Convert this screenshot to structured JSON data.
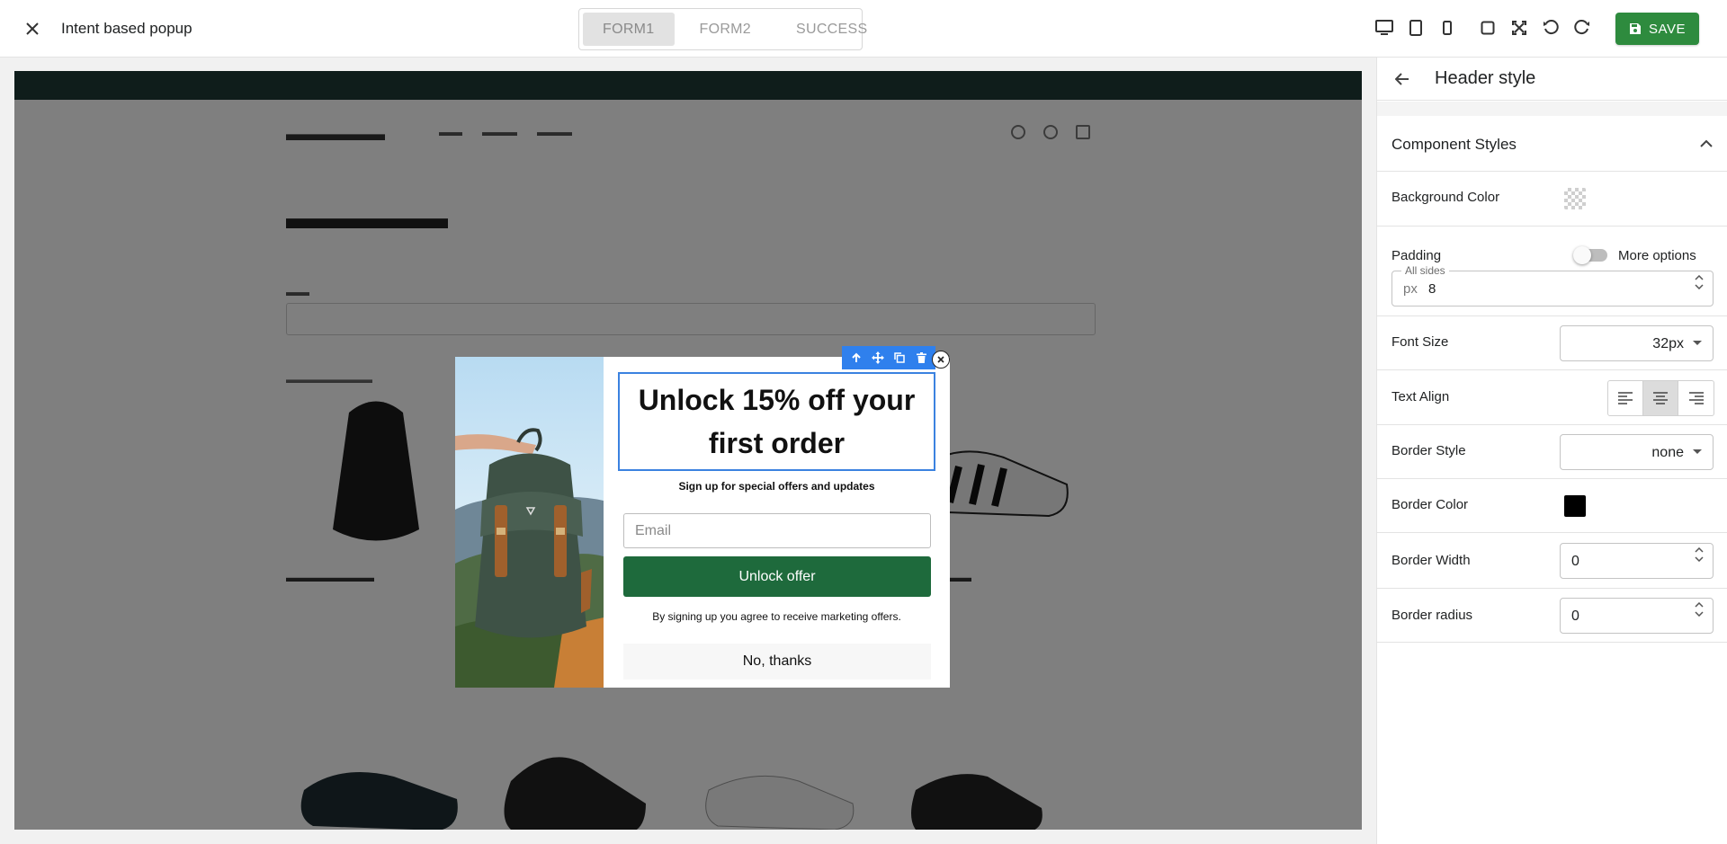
{
  "app": {
    "title": "Intent based popup"
  },
  "tabs": [
    "FORM1",
    "FORM2",
    "SUCCESS"
  ],
  "active_tab": "FORM1",
  "toolbar": {
    "save_label": "SAVE"
  },
  "popup": {
    "heading": "Unlock 15% off your first order",
    "subheading": "Sign up for special offers and updates",
    "email_placeholder": "Email",
    "submit_label": "Unlock offer",
    "disclaimer": "By signing up you agree to receive marketing offers.",
    "dismiss_label": "No, thanks",
    "submit_color": "#1e6a3c"
  },
  "panel": {
    "title": "Header style",
    "section_title": "Component Styles",
    "background_color_label": "Background Color",
    "background_color_value": "transparent",
    "padding_label": "Padding",
    "more_options_label": "More options",
    "more_options_enabled": false,
    "all_sides_legend": "All sides",
    "padding_unit": "px",
    "padding_value": "8",
    "font_size_label": "Font Size",
    "font_size_value": "32px",
    "text_align_label": "Text Align",
    "text_align_value": "center",
    "border_style_label": "Border Style",
    "border_style_value": "none",
    "border_color_label": "Border Color",
    "border_color_value": "#000000",
    "border_width_label": "Border Width",
    "border_width_value": "0",
    "border_radius_label": "Border radius",
    "border_radius_value": "0"
  },
  "colors": {
    "accent_blue": "#2f80ed",
    "save_green": "#2e8b3e"
  }
}
